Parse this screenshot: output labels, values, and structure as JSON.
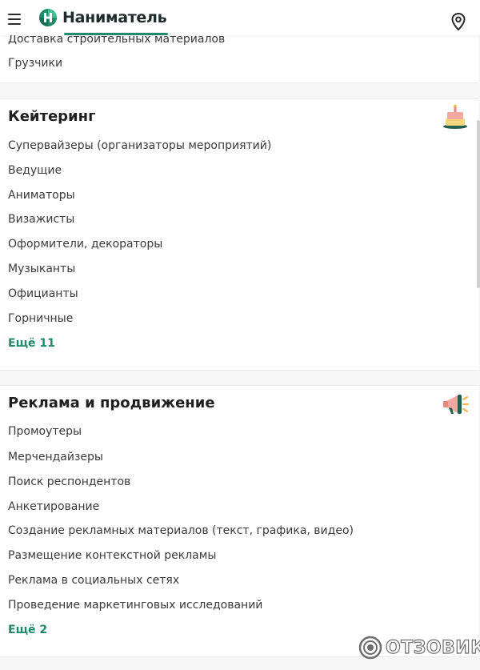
{
  "header": {
    "logo_text": "Наниматель",
    "menu_icon": "hamburger-icon",
    "location_icon": "map-pin-icon",
    "brand_color": "#1f8a6a"
  },
  "top_section": {
    "items": [
      "Доставка строительных материалов",
      "Грузчики"
    ]
  },
  "catering": {
    "title": "Кейтеринг",
    "icon": "cake-icon",
    "items": [
      "Супервайзеры (организаторы мероприятий)",
      "Ведущие",
      "Аниматоры",
      "Визажисты",
      "Оформители, декораторы",
      "Музыканты",
      "Официанты",
      "Горничные"
    ],
    "more": "Ещё 11"
  },
  "advertising": {
    "title": "Реклама и продвижение",
    "icon": "megaphone-icon",
    "items": [
      "Промоутеры",
      "Мерчендайзеры",
      "Поиск респондентов",
      "Анкетирование",
      "Создание рекламных материалов (текст, графика, видео)",
      "Размещение контекстной рекламы",
      "Реклама в социальных сетях",
      "Проведение маркетинговых исследований"
    ],
    "more": "Ещё 2"
  },
  "watermark": {
    "text": "ОТЗОВИК"
  }
}
